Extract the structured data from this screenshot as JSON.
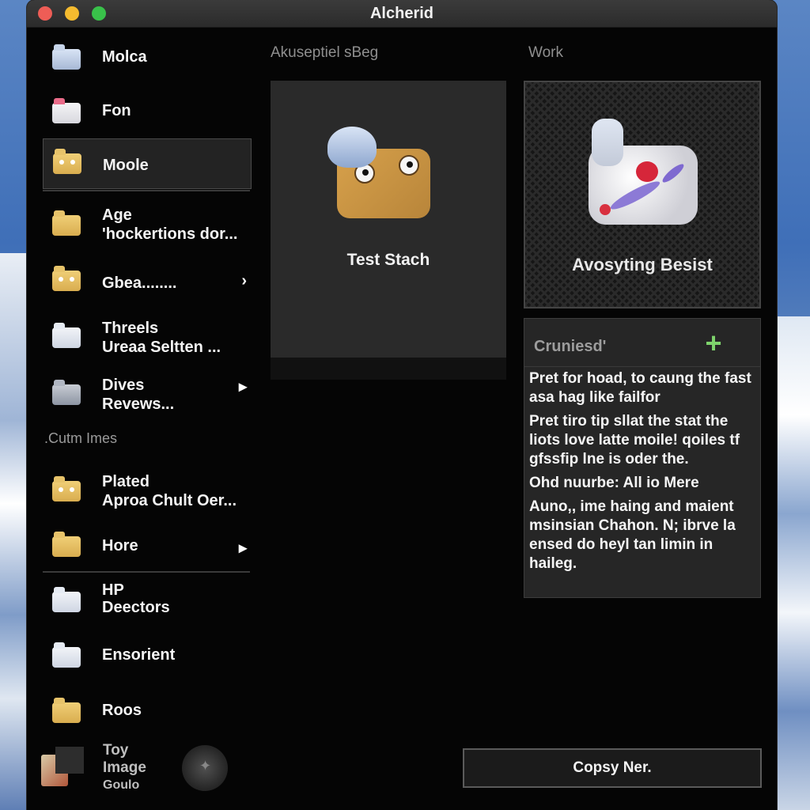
{
  "window": {
    "title": "Alcherid"
  },
  "sidebar": {
    "items": [
      {
        "label": "Molca",
        "icon": "photo-folder-icon"
      },
      {
        "label": "Fon",
        "icon": "pink-folder-icon"
      },
      {
        "label": "Moole",
        "icon": "face-folder-icon",
        "selected": true
      },
      {
        "label": "Age",
        "sublabel": "'hockertions dor...",
        "icon": "folder-icon"
      },
      {
        "label": "Gbea........",
        "icon": "face-folder-icon"
      },
      {
        "label": "Threels",
        "sublabel": "Ureaa Seltten ...",
        "icon": "white-folder-icon"
      },
      {
        "label": "Dives",
        "sublabel": "Revews...",
        "icon": "gray-folder-icon"
      }
    ],
    "section_title": ".Cutm Imes",
    "section_items": [
      {
        "label": "Plated",
        "sublabel": "Aproa Chult Oer...",
        "icon": "face-folder-icon"
      },
      {
        "label": "Hore",
        "icon": "folder-icon"
      },
      {
        "label": "HP",
        "sublabel": "Deectors",
        "icon": "white-folder-icon"
      },
      {
        "label": "Ensorient",
        "icon": "white-folder-icon"
      },
      {
        "label": "Roos",
        "icon": "folder-icon"
      }
    ],
    "footer": {
      "line1": "Toy",
      "line2": "Image",
      "line3": "Goulo"
    }
  },
  "main": {
    "left_header": "Akuseptiel sBeg",
    "right_header": "Work",
    "card_left_caption": "Test Stach",
    "card_right_caption": "Avosyting Besist",
    "notes": {
      "title": "Cruniesd'",
      "paragraphs": [
        "Pret for hoad, to caung the fast asa hag like failfor",
        "Pret tiro tip sllat the stat the liots love latte moile! qoiles tf gfssfip lne is oder the.",
        "Ohd nuurbe: All io Mere",
        "Auno,, ime haing and maient msinsian Chahon. N; ibrve la ensed do heyl tan limin in haileg."
      ]
    },
    "copy_button": "Copsy Ner."
  },
  "colors": {
    "accent_plus": "#7ed36c",
    "window_bg": "#050505",
    "selected_row": "#232323"
  }
}
